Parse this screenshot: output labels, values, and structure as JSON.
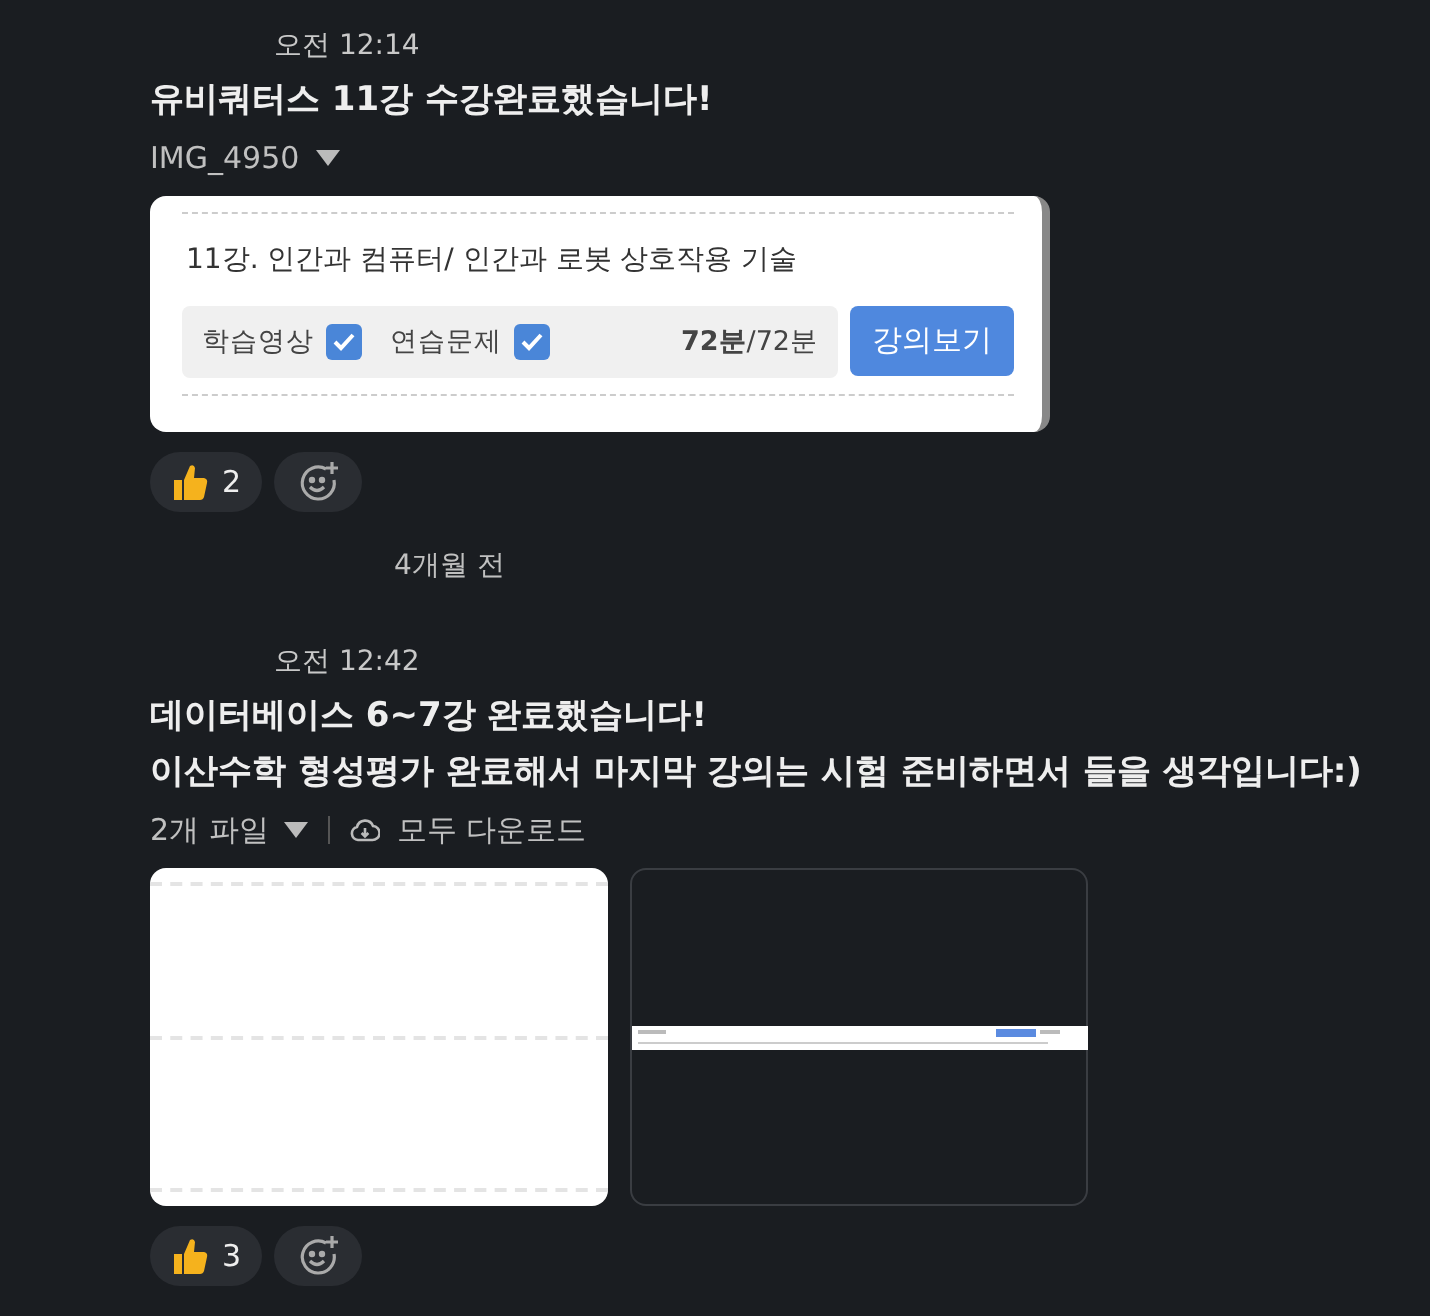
{
  "messages": [
    {
      "time": "오전 12:14",
      "lines": [
        "유비쿼터스 11강 수강완료했습니다!"
      ],
      "file_label": "IMG_4950",
      "attachment": {
        "kind": "lecture_card",
        "title": "11강. 인간과 컴퓨터/ 인간과 로봇 상호작용 기술",
        "checks": [
          {
            "label": "학습영상",
            "checked": true
          },
          {
            "label": "연습문제",
            "checked": true
          }
        ],
        "progress": "**72분**/72분",
        "button": "강의보기"
      },
      "reactions": [
        {
          "count": "2"
        }
      ]
    },
    {
      "divider": "4개월 전",
      "time": "오전 12:42",
      "lines": [
        "데이터베이스 6~7강 완료했습니다!",
        "이산수학 형성평가 완료해서 마지막 강의는 시험 준비하면서 들을 생각입니다:)"
      ],
      "file_label": "2개 파일",
      "download": "모두 다운로드",
      "attachment": {
        "kind": "thumbnails",
        "items": [
          {
            "kind": "blank_page"
          },
          {
            "kind": "screenshot_strip"
          }
        ]
      },
      "reactions": [
        {
          "count": "3"
        }
      ]
    }
  ]
}
